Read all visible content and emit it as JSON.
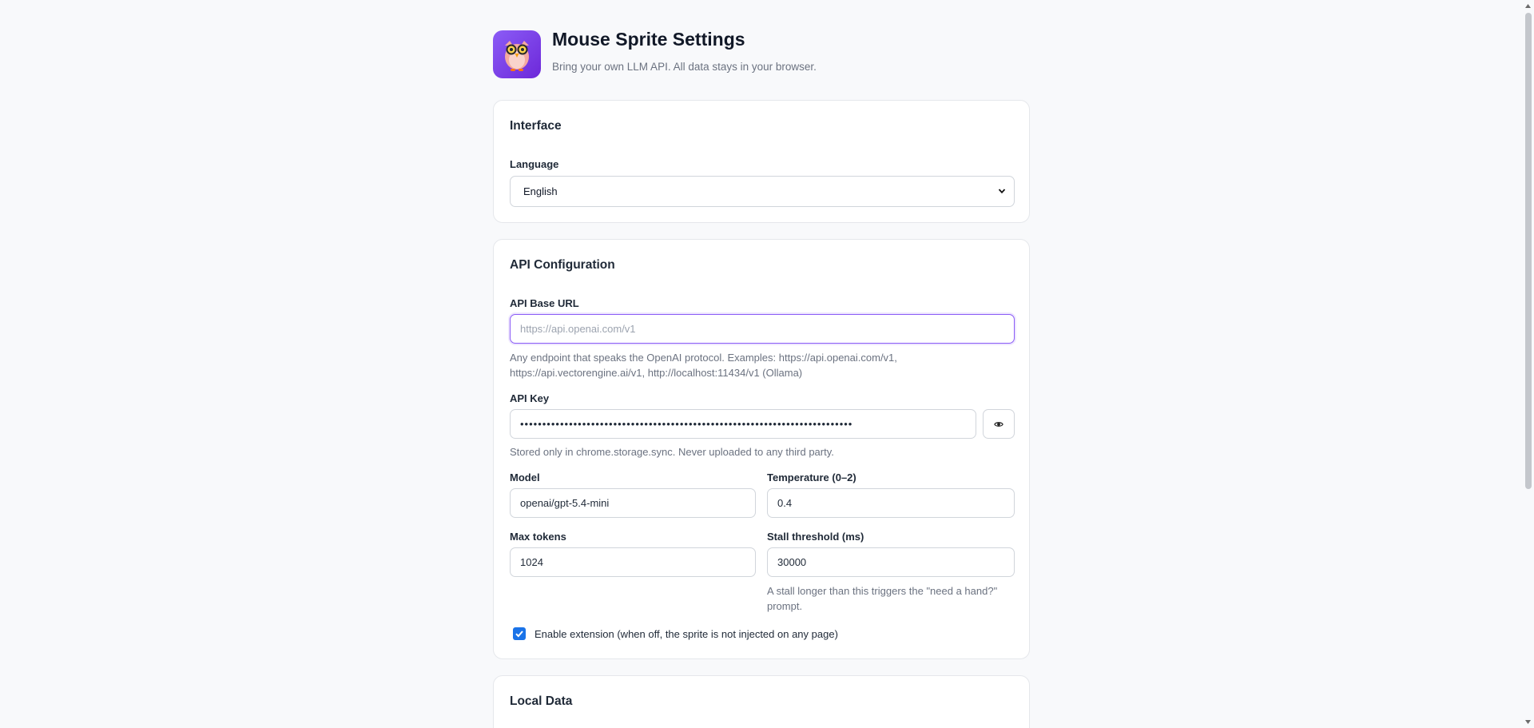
{
  "header": {
    "title": "Mouse Sprite Settings",
    "subtitle": "Bring your own LLM API. All data stays in your browser.",
    "logo_icon": "owl-icon"
  },
  "interface": {
    "title": "Interface",
    "language_label": "Language",
    "language_value": "English"
  },
  "api": {
    "title": "API Configuration",
    "base_url_label": "API Base URL",
    "base_url_value": "",
    "base_url_placeholder": "https://api.openai.com/v1",
    "base_url_help_line1": "Any endpoint that speaks the OpenAI protocol. Examples: https://api.openai.com/v1,",
    "base_url_help_line2": "https://api.vectorengine.ai/v1, http://localhost:11434/v1 (Ollama)",
    "key_label": "API Key",
    "key_value": "sk-••••••••••••••••••••••••••••••••••••••••••••••••••••••••••••••••••••••••",
    "key_help": "Stored only in chrome.storage.sync. Never uploaded to any third party.",
    "show_key_icon": "eye-icon",
    "model_label": "Model",
    "model_value": "openai/gpt-5.4-mini",
    "temperature_label": "Temperature (0–2)",
    "temperature_value": "0.4",
    "max_tokens_label": "Max tokens",
    "max_tokens_value": "1024",
    "stall_label": "Stall threshold (ms)",
    "stall_value": "30000",
    "stall_help_line1": "A stall longer than this triggers the \"need a hand?\"",
    "stall_help_line2": "prompt.",
    "enable_label": "Enable extension (when off, the sprite is not injected on any page)",
    "enable_checked": true
  },
  "local_data": {
    "title": "Local Data"
  },
  "colors": {
    "accent": "#8b5cf6",
    "checkbox": "#1a73e8",
    "background": "#f8f9fb"
  }
}
